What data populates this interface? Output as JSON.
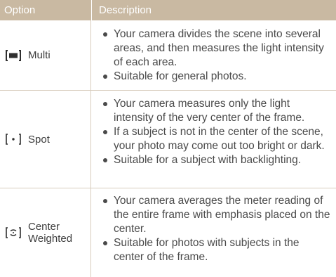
{
  "header": {
    "option": "Option",
    "description": "Description"
  },
  "rows": [
    {
      "icon": "multi-metering-icon",
      "label": "Multi",
      "bullets": [
        "Your camera divides the scene into several areas, and then measures the light intensity of each area.",
        "Suitable for general photos."
      ]
    },
    {
      "icon": "spot-metering-icon",
      "label": "Spot",
      "bullets": [
        "Your camera measures only the light intensity of the very center of the frame.",
        "If a subject is not in the center of the scene, your photo may come out too bright or dark.",
        "Suitable for a subject with backlighting."
      ]
    },
    {
      "icon": "center-weighted-metering-icon",
      "label": "Center Weighted",
      "bullets": [
        "Your camera averages the meter reading of the entire frame with emphasis placed on the center.",
        "Suitable for photos with subjects in the center of the frame."
      ]
    }
  ],
  "colors": {
    "header_bg": "#c9b9a2",
    "rule": "#d8cdbd"
  }
}
